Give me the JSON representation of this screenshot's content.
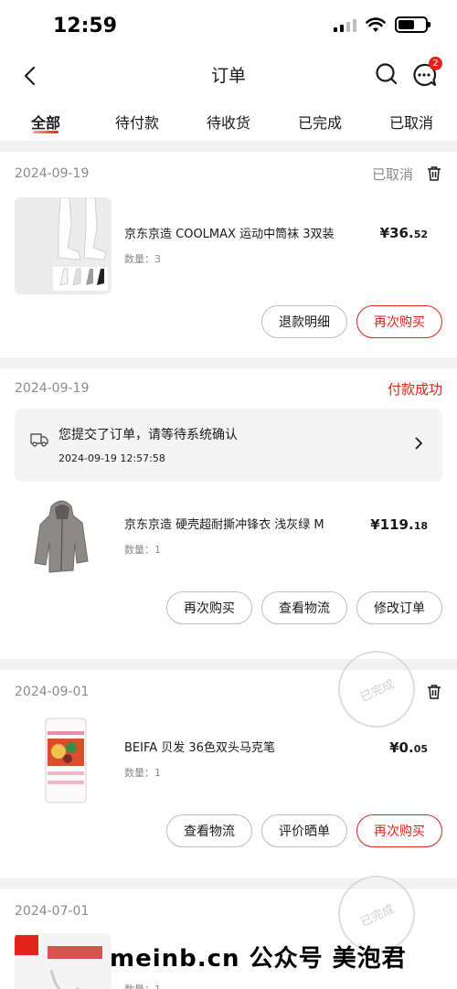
{
  "status_bar": {
    "time": "12:59"
  },
  "header": {
    "title": "订单",
    "message_badge": "2"
  },
  "tabs": [
    {
      "label": "全部",
      "active": true
    },
    {
      "label": "待付款"
    },
    {
      "label": "待收货"
    },
    {
      "label": "已完成"
    },
    {
      "label": "已取消"
    }
  ],
  "orders": [
    {
      "date": "2024-09-19",
      "status": "已取消",
      "item_title": "京东京造 COOLMAX 运动中筒袜 3双装",
      "qty": "数量：3",
      "price_int": "¥36.",
      "price_dec": "52",
      "buttons": [
        "退款明细",
        "再次购买"
      ]
    },
    {
      "date": "2024-09-19",
      "status": "付款成功",
      "notice_text": "您提交了订单，请等待系统确认",
      "notice_time": "2024-09-19 12:57:58",
      "item_title": "京东京造 硬壳超耐撕冲锋衣 浅灰绿 M",
      "qty": "数量：1",
      "price_int": "¥119.",
      "price_dec": "18",
      "buttons": [
        "再次购买",
        "查看物流",
        "修改订单"
      ]
    },
    {
      "date": "2024-09-01",
      "item_title": "BEIFA 贝发 36色双头马克笔",
      "qty": "数量：1",
      "price_int": "¥0.",
      "price_dec": "05",
      "buttons": [
        "查看物流",
        "评价晒单",
        "再次购买"
      ]
    },
    {
      "date": "2024-07-01",
      "qty": "数量：1"
    }
  ],
  "stamps": [
    "已完成",
    "已完成"
  ],
  "watermark": "meinb.cn 公众号 美泡君",
  "colors": {
    "accent": "#e2231a",
    "muted": "#8a8a8a"
  }
}
